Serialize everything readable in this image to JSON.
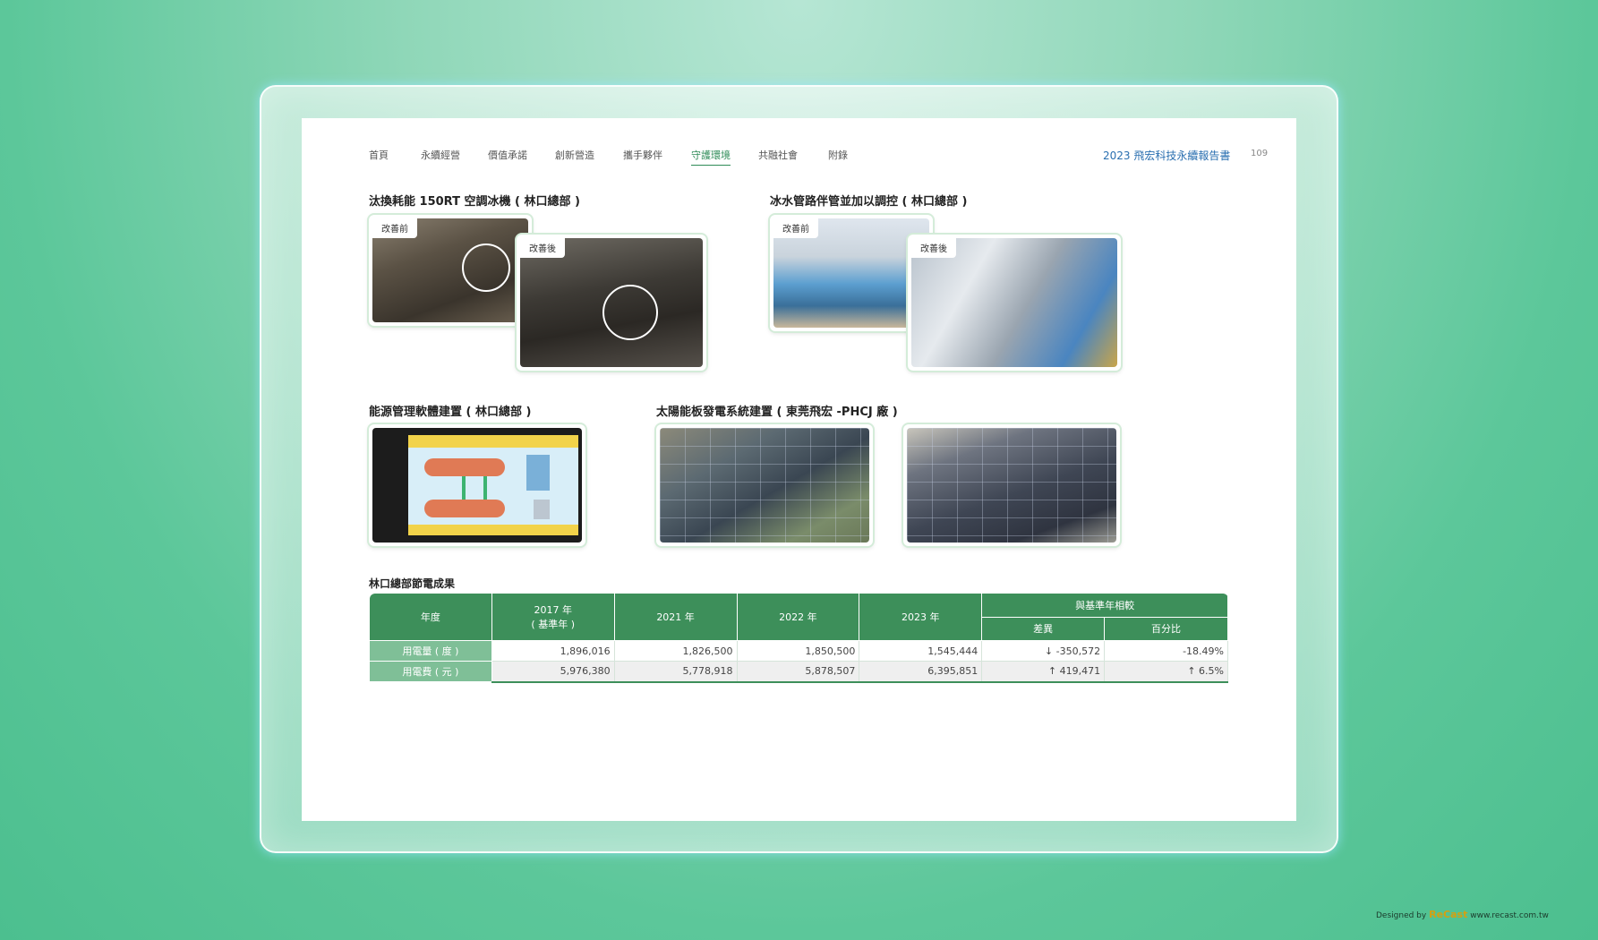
{
  "nav": {
    "items": [
      "首頁",
      "永續經營",
      "價值承諾",
      "創新營造",
      "攜手夥伴",
      "守護環境",
      "共融社會",
      "附錄"
    ],
    "active_index": 5
  },
  "header": {
    "report_title": "2023 飛宏科技永續報告書",
    "page_number": "109"
  },
  "sections": {
    "chiller": {
      "title": "汰換耗能 150RT 空調冰機 ( 林口總部 )",
      "before_label": "改善前",
      "after_label": "改善後"
    },
    "pipe": {
      "title": "冰水管路伴管並加以調控 ( 林口總部 )",
      "before_label": "改善前",
      "after_label": "改善後"
    },
    "ems": {
      "title": "能源管理軟體建置 ( 林口總部 )"
    },
    "solar": {
      "title": "太陽能板發電系統建置 ( 東莞飛宏 -PHCJ 廠 )"
    }
  },
  "energy_table": {
    "title": "林口總部節電成果",
    "headers": {
      "year": "年度",
      "y2017": "2017 年",
      "y2017_sub": "( 基準年 )",
      "y2021": "2021 年",
      "y2022": "2022 年",
      "y2023": "2023 年",
      "compare": "與基準年相較",
      "diff": "差異",
      "pct": "百分比"
    },
    "rows": [
      {
        "label": "用電量 ( 度 )",
        "v2017": "1,896,016",
        "v2021": "1,826,500",
        "v2022": "1,850,500",
        "v2023": "1,545,444",
        "diff": "↓ -350,572",
        "pct": "-18.49%"
      },
      {
        "label": "用電費 ( 元 )",
        "v2017": "5,976,380",
        "v2021": "5,778,918",
        "v2022": "5,878,507",
        "v2023": "6,395,851",
        "diff": "↑ 419,471",
        "pct": "↑ 6.5%"
      }
    ]
  },
  "credit": {
    "designed_by": "Designed by",
    "brand": "ReCast",
    "url": "www.recast.com.tw"
  },
  "colors": {
    "accent_green": "#3d8f5a",
    "row_label_green": "#7fbf97",
    "report_title_blue": "#2a6fb0"
  }
}
